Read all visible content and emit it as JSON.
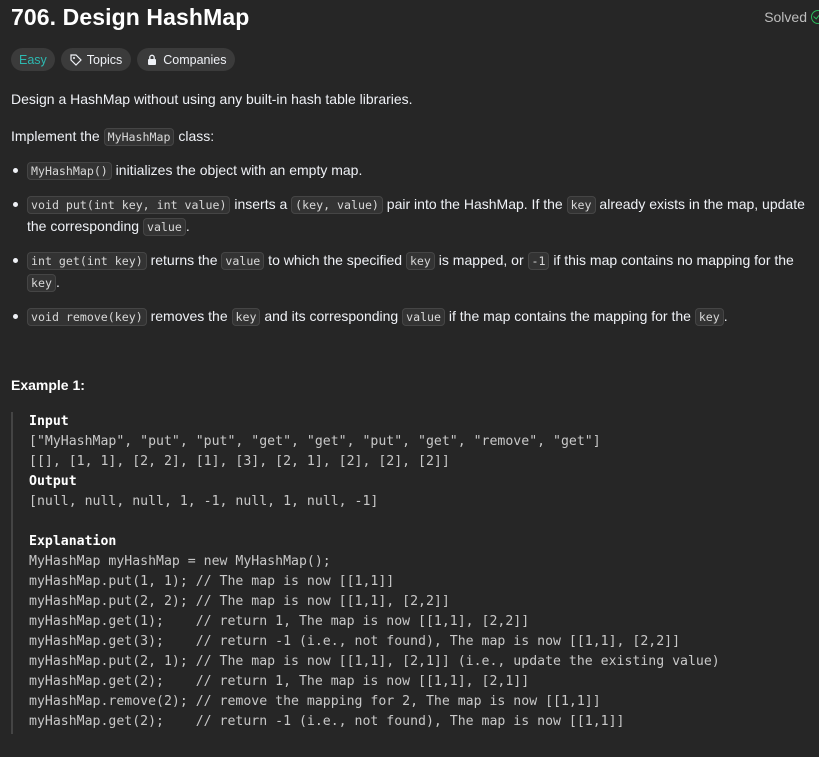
{
  "problem": {
    "title": "706. Design HashMap",
    "status": "Solved",
    "difficulty": "Easy",
    "topics_label": "Topics",
    "companies_label": "Companies"
  },
  "description": {
    "intro": "Design a HashMap without using any built-in hash table libraries.",
    "implement_prefix": "Implement the ",
    "implement_code": "MyHashMap",
    "implement_suffix": " class:",
    "bullets": [
      {
        "p0": "",
        "c0": "MyHashMap()",
        "p1": " initializes the object with an empty map."
      },
      {
        "c0": "void put(int key, int value)",
        "p1": " inserts a ",
        "c1": "(key, value)",
        "p2": " pair into the HashMap. If the ",
        "c2": "key",
        "p3": " already exists in the map, update",
        "p4": "the corresponding ",
        "c3": "value",
        "p5": "."
      },
      {
        "c0": "int get(int key)",
        "p1": " returns the ",
        "c1": "value",
        "p2": " to which the specified ",
        "c2": "key",
        "p3": " is mapped, or ",
        "c3": "-1",
        "p4": " if this map contains no mapping for the",
        "c4": "key",
        "p5": "."
      },
      {
        "c0": "void remove(key)",
        "p1": " removes the ",
        "c1": "key",
        "p2": " and its corresponding ",
        "c2": "value",
        "p3": " if the map contains the mapping for the ",
        "c3": "key",
        "p4": "."
      }
    ]
  },
  "example": {
    "title": "Example 1:",
    "input_label": "Input",
    "input_line1": "[\"MyHashMap\", \"put\", \"put\", \"get\", \"get\", \"put\", \"get\", \"remove\", \"get\"]",
    "input_line2": "[[], [1, 1], [2, 2], [1], [3], [2, 1], [2], [2], [2]]",
    "output_label": "Output",
    "output_line": "[null, null, null, 1, -1, null, 1, null, -1]",
    "explanation_label": "Explanation",
    "explanation_lines": [
      "MyHashMap myHashMap = new MyHashMap();",
      "myHashMap.put(1, 1); // The map is now [[1,1]]",
      "myHashMap.put(2, 2); // The map is now [[1,1], [2,2]]",
      "myHashMap.get(1);    // return 1, The map is now [[1,1], [2,2]]",
      "myHashMap.get(3);    // return -1 (i.e., not found), The map is now [[1,1], [2,2]]",
      "myHashMap.put(2, 1); // The map is now [[1,1], [2,1]] (i.e., update the existing value)",
      "myHashMap.get(2);    // return 1, The map is now [[1,1], [2,1]]",
      "myHashMap.remove(2); // remove the mapping for 2, The map is now [[1,1]]",
      "myHashMap.get(2);    // return -1 (i.e., not found), The map is now [[1,1]]"
    ]
  },
  "colors": {
    "background": "#262626",
    "easy": "#2db8b0",
    "solved_check": "#2cbb5d"
  }
}
